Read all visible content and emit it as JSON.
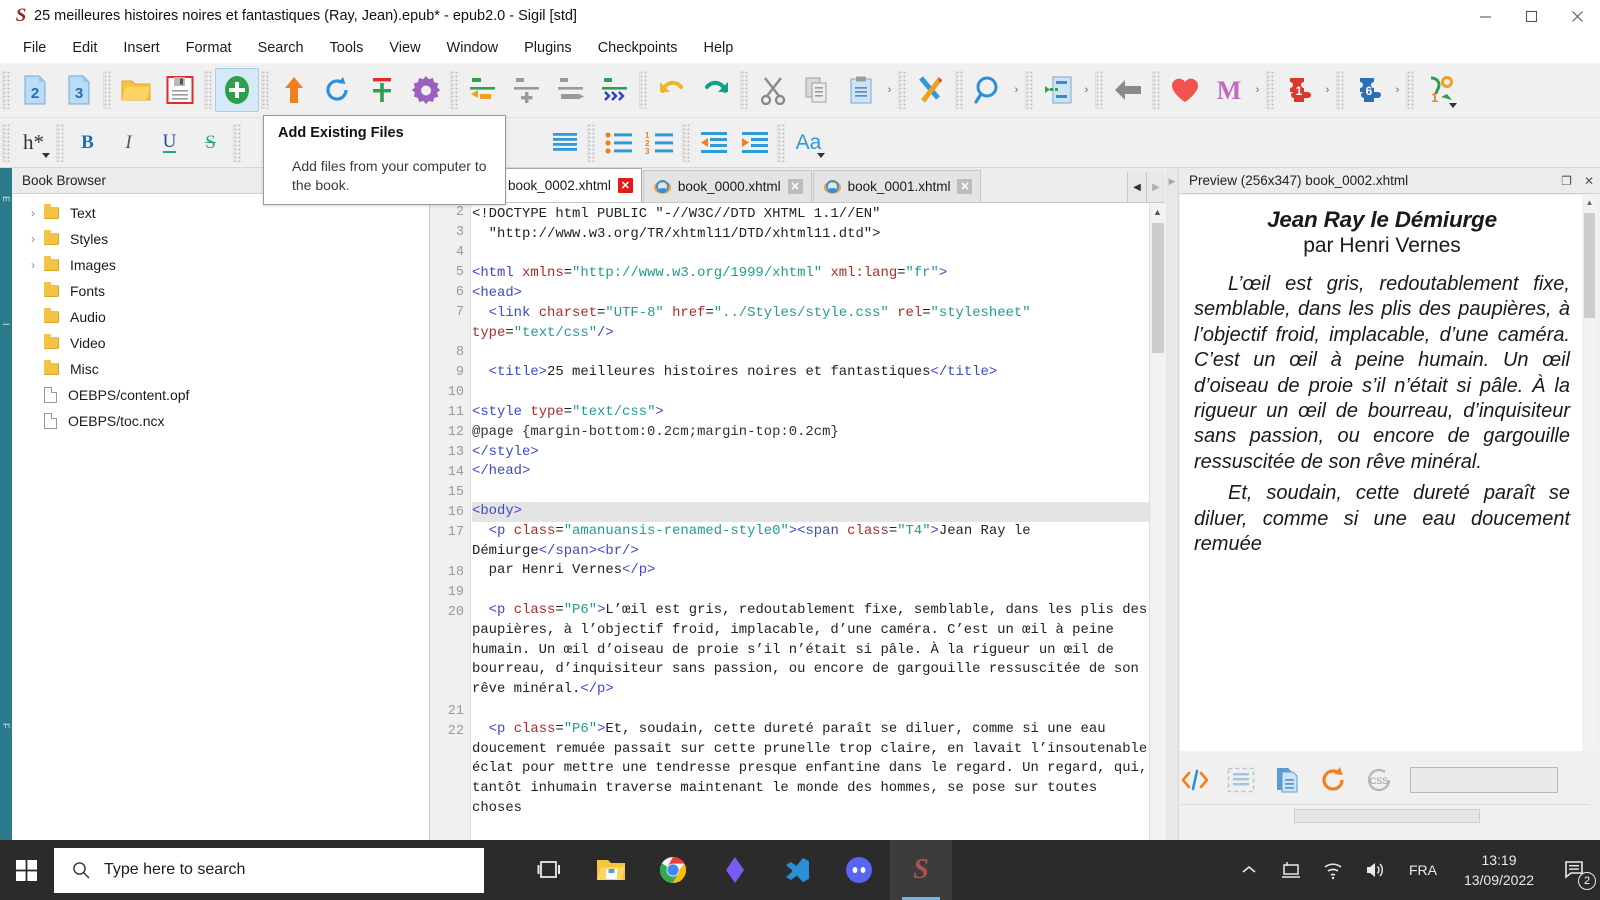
{
  "window": {
    "title": "25 meilleures histoires noires et fantastiques (Ray, Jean).epub* - epub2.0 - Sigil [std]",
    "app_glyph": "S",
    "minimize": "—",
    "maximize": "□",
    "close": "✕"
  },
  "menubar": {
    "items": [
      "File",
      "Edit",
      "Insert",
      "Format",
      "Search",
      "Tools",
      "View",
      "Window",
      "Plugins",
      "Checkpoints",
      "Help"
    ]
  },
  "toolbar_row1": {
    "groups": [
      {
        "buttons": [
          {
            "name": "epub2-icon",
            "label": "2"
          },
          {
            "name": "epub3-icon",
            "label": "3"
          }
        ]
      },
      {
        "buttons": [
          {
            "name": "open-folder-icon",
            "label": ""
          },
          {
            "name": "save-icon",
            "label": ""
          }
        ]
      },
      {
        "buttons": [
          {
            "name": "add-existing-files-icon",
            "label": "",
            "active": true
          }
        ]
      },
      {
        "buttons": [
          {
            "name": "upload-icon",
            "label": ""
          },
          {
            "name": "reload-icon",
            "label": ""
          },
          {
            "name": "add-blank-section-icon",
            "label": ""
          },
          {
            "name": "preferences-gear-icon",
            "label": ""
          }
        ]
      },
      {
        "buttons": [
          {
            "name": "split-at-cursor-icon",
            "label": ""
          },
          {
            "name": "insert-section-icon",
            "label": ""
          },
          {
            "name": "merge-icon",
            "label": ""
          },
          {
            "name": "split-at-markers-icon",
            "label": ""
          }
        ]
      },
      {
        "buttons": [
          {
            "name": "undo-icon",
            "label": ""
          },
          {
            "name": "redo-icon",
            "label": ""
          }
        ]
      },
      {
        "buttons": [
          {
            "name": "cut-icon",
            "label": ""
          },
          {
            "name": "copy-icon",
            "label": ""
          },
          {
            "name": "paste-icon",
            "label": ""
          }
        ]
      },
      {
        "buttons": [
          {
            "name": "metadata-editor-icon",
            "label": ""
          }
        ]
      },
      {
        "buttons": [
          {
            "name": "find-replace-icon",
            "label": ""
          }
        ]
      },
      {
        "buttons": [
          {
            "name": "generate-toc-icon",
            "label": ""
          }
        ]
      },
      {
        "buttons": [
          {
            "name": "back-arrow-icon",
            "label": ""
          }
        ]
      },
      {
        "buttons": [
          {
            "name": "heart-plugin-icon",
            "label": ""
          },
          {
            "name": "m-plugin-icon",
            "label": ""
          }
        ]
      },
      {
        "buttons": [
          {
            "name": "plugin-1-icon",
            "label": "1"
          }
        ]
      },
      {
        "buttons": [
          {
            "name": "plugin-6-icon",
            "label": "6"
          }
        ]
      },
      {
        "buttons": [
          {
            "name": "plugin-tools-icon",
            "label": ""
          }
        ]
      }
    ]
  },
  "toolbar_row2": {
    "heading_label": "h*",
    "bold_label": "B",
    "italic_label": "I",
    "underline_label": "U",
    "strike_label": "S",
    "case_label": "Aa",
    "buttons": [
      {
        "name": "heading-dropdown"
      },
      {
        "name": "bold-button"
      },
      {
        "name": "italic-button"
      },
      {
        "name": "underline-button"
      },
      {
        "name": "strikethrough-button"
      },
      {
        "name": "align-justify-button"
      },
      {
        "name": "bullet-list-button"
      },
      {
        "name": "numbered-list-button"
      },
      {
        "name": "decrease-indent-button"
      },
      {
        "name": "increase-indent-button"
      },
      {
        "name": "change-case-button"
      }
    ]
  },
  "tooltip": {
    "title": "Add Existing Files",
    "body": "Add files from your computer to the book."
  },
  "book_browser": {
    "panel_title": "Book Browser",
    "items": [
      {
        "label": "Text",
        "type": "folder",
        "expandable": true,
        "twisty": "›"
      },
      {
        "label": "Styles",
        "type": "folder",
        "expandable": true,
        "twisty": "›"
      },
      {
        "label": "Images",
        "type": "folder",
        "expandable": true,
        "twisty": "›"
      },
      {
        "label": "Fonts",
        "type": "folder",
        "expandable": false,
        "twisty": ""
      },
      {
        "label": "Audio",
        "type": "folder",
        "expandable": false,
        "twisty": ""
      },
      {
        "label": "Video",
        "type": "folder",
        "expandable": false,
        "twisty": ""
      },
      {
        "label": "Misc",
        "type": "folder",
        "expandable": false,
        "twisty": ""
      },
      {
        "label": "OEBPS/content.opf",
        "type": "file",
        "expandable": false,
        "twisty": ""
      },
      {
        "label": "OEBPS/toc.ncx",
        "type": "file",
        "expandable": false,
        "twisty": ""
      }
    ]
  },
  "left_strip": {
    "labels": [
      "E",
      "I",
      "F"
    ]
  },
  "tabs": {
    "items": [
      {
        "label": "book_0002.xhtml",
        "active": true
      },
      {
        "label": "book_0000.xhtml",
        "active": false
      },
      {
        "label": "book_0001.xhtml",
        "active": false
      }
    ],
    "close_glyph": "✕",
    "nav_prev": "◀",
    "nav_next": "▶"
  },
  "editor": {
    "first_line_number": 2,
    "highlighted_line": 16,
    "line_numbers": [
      2,
      3,
      4,
      5,
      6,
      7,
      8,
      9,
      10,
      11,
      12,
      13,
      14,
      15,
      16,
      17,
      18,
      19,
      20,
      21,
      22
    ],
    "lines": [
      {
        "n": 2,
        "segments": [
          {
            "t": "plain",
            "s": "<!DOCTYPE html PUBLIC \"-//W3C//DTD XHTML 1.1//EN\""
          }
        ]
      },
      {
        "n": 3,
        "segments": [
          {
            "t": "plain",
            "s": "  \"http://www.w3.org/TR/xhtml11/DTD/xhtml11.dtd\">"
          }
        ]
      },
      {
        "n": 4,
        "segments": [
          {
            "t": "plain",
            "s": ""
          }
        ]
      },
      {
        "n": 5,
        "segments": [
          {
            "t": "tagc",
            "s": "<html "
          },
          {
            "t": "attrc",
            "s": "xmlns"
          },
          {
            "t": "plain",
            "s": "="
          },
          {
            "t": "valc",
            "s": "\"http://www.w3.org/1999/xhtml\""
          },
          {
            "t": "plain",
            "s": " "
          },
          {
            "t": "attrc",
            "s": "xml:lang"
          },
          {
            "t": "plain",
            "s": "="
          },
          {
            "t": "valc",
            "s": "\"fr\""
          },
          {
            "t": "tagc",
            "s": ">"
          }
        ]
      },
      {
        "n": 6,
        "segments": [
          {
            "t": "tagc",
            "s": "<head>"
          }
        ]
      },
      {
        "n": 7,
        "segments": [
          {
            "t": "plain",
            "s": "  "
          },
          {
            "t": "tagc",
            "s": "<link "
          },
          {
            "t": "attrc",
            "s": "charset"
          },
          {
            "t": "plain",
            "s": "="
          },
          {
            "t": "valc",
            "s": "\"UTF-8\""
          },
          {
            "t": "plain",
            "s": " "
          },
          {
            "t": "attrc",
            "s": "href"
          },
          {
            "t": "plain",
            "s": "="
          },
          {
            "t": "valc",
            "s": "\"../Styles/style.css\""
          },
          {
            "t": "plain",
            "s": " "
          },
          {
            "t": "attrc",
            "s": "rel"
          },
          {
            "t": "plain",
            "s": "="
          },
          {
            "t": "valc",
            "s": "\"stylesheet\""
          },
          {
            "t": "plain",
            "s": " "
          },
          {
            "t": "attrc",
            "s": "type"
          },
          {
            "t": "plain",
            "s": "="
          },
          {
            "t": "valc",
            "s": "\"text/css\""
          },
          {
            "t": "tagc",
            "s": "/>"
          }
        ]
      },
      {
        "n": 8,
        "segments": [
          {
            "t": "plain",
            "s": ""
          }
        ]
      },
      {
        "n": 9,
        "segments": [
          {
            "t": "plain",
            "s": "  "
          },
          {
            "t": "tagc",
            "s": "<title>"
          },
          {
            "t": "plain",
            "s": "25 meilleures histoires noires et fantastiques"
          },
          {
            "t": "tagc",
            "s": "</title>"
          }
        ]
      },
      {
        "n": 10,
        "segments": [
          {
            "t": "plain",
            "s": ""
          }
        ]
      },
      {
        "n": 11,
        "segments": [
          {
            "t": "tagc",
            "s": "<style "
          },
          {
            "t": "attrc",
            "s": "type"
          },
          {
            "t": "plain",
            "s": "="
          },
          {
            "t": "valc",
            "s": "\"text/css\""
          },
          {
            "t": "tagc",
            "s": ">"
          }
        ]
      },
      {
        "n": 12,
        "segments": [
          {
            "t": "csstxt",
            "s": "@page {margin-bottom:0.2cm;margin-top:0.2cm}"
          }
        ]
      },
      {
        "n": 13,
        "segments": [
          {
            "t": "tagc",
            "s": "</style>"
          }
        ]
      },
      {
        "n": 14,
        "segments": [
          {
            "t": "tagc",
            "s": "</head>"
          }
        ]
      },
      {
        "n": 15,
        "segments": [
          {
            "t": "plain",
            "s": ""
          }
        ]
      },
      {
        "n": 16,
        "segments": [
          {
            "t": "tagc",
            "s": "<body>"
          }
        ],
        "highlight": true
      },
      {
        "n": 17,
        "segments": [
          {
            "t": "plain",
            "s": "  "
          },
          {
            "t": "tagc",
            "s": "<p "
          },
          {
            "t": "attrc",
            "s": "class"
          },
          {
            "t": "plain",
            "s": "="
          },
          {
            "t": "valc",
            "s": "\"amanuansis-renamed-style0\""
          },
          {
            "t": "tagc",
            "s": "><span "
          },
          {
            "t": "attrc",
            "s": "class"
          },
          {
            "t": "plain",
            "s": "="
          },
          {
            "t": "valc",
            "s": "\"T4\""
          },
          {
            "t": "tagc",
            "s": ">"
          },
          {
            "t": "plain",
            "s": "Jean Ray le Démiurge"
          },
          {
            "t": "tagc",
            "s": "</span><br/>"
          }
        ]
      },
      {
        "n": 18,
        "segments": [
          {
            "t": "plain",
            "s": "  par Henri Vernes"
          },
          {
            "t": "tagc",
            "s": "</p>"
          }
        ]
      },
      {
        "n": 19,
        "segments": [
          {
            "t": "plain",
            "s": ""
          }
        ]
      },
      {
        "n": 20,
        "segments": [
          {
            "t": "plain",
            "s": "  "
          },
          {
            "t": "tagc",
            "s": "<p "
          },
          {
            "t": "attrc",
            "s": "class"
          },
          {
            "t": "plain",
            "s": "="
          },
          {
            "t": "valc",
            "s": "\"P6\""
          },
          {
            "t": "tagc",
            "s": ">"
          },
          {
            "t": "plain",
            "s": "L’œil est gris, redoutablement fixe, semblable, dans les plis des paupières, à l’objectif froid, implacable, d’une caméra. C’est un œil à peine humain. Un œil d’oiseau de proie s’il n’était si pâle. À la rigueur un œil de bourreau, d’inquisiteur sans passion, ou encore de gargouille ressuscitée de son rêve minéral."
          },
          {
            "t": "tagc",
            "s": "</p>"
          }
        ]
      },
      {
        "n": 21,
        "segments": [
          {
            "t": "plain",
            "s": ""
          }
        ]
      },
      {
        "n": 22,
        "segments": [
          {
            "t": "plain",
            "s": "  "
          },
          {
            "t": "tagc",
            "s": "<p "
          },
          {
            "t": "attrc",
            "s": "class"
          },
          {
            "t": "plain",
            "s": "="
          },
          {
            "t": "valc",
            "s": "\"P6\""
          },
          {
            "t": "tagc",
            "s": ">"
          },
          {
            "t": "plain",
            "s": "Et, soudain, cette dureté paraît se diluer, comme si une eau doucement remuée passait sur cette prunelle trop claire, en lavait l’insoutenable éclat pour mettre une tendresse presque enfantine dans le regard. Un regard, qui, tantôt inhumain traverse maintenant le monde des hommes, se pose sur toutes choses"
          }
        ]
      }
    ]
  },
  "preview": {
    "title": "Preview (256x347) book_0002.xhtml",
    "float_glyph": "❐",
    "close_glyph": "✕",
    "heading": "Jean Ray le Démiurge",
    "subheading": "par Henri Vernes",
    "paragraphs": [
      "L’œil est gris, redoutablement fixe, semblable, dans les plis des paupières, à l’objectif froid, implacable, d’une caméra. C’est un œil à peine humain. Un œil d’oiseau de proie s’il n’était si pâle. À la rigueur un œil de bourreau, d’inquisiteur sans passion, ou encore de gargouille ressuscitée de son rêve minéral.",
      "Et, soudain, cette dureté paraît se diluer, comme si une eau doucement remuée"
    ],
    "toolbar_buttons": [
      {
        "name": "code-view-icon",
        "label": "</>"
      },
      {
        "name": "split-view-icon",
        "label": ""
      },
      {
        "name": "book-view-icon",
        "label": ""
      },
      {
        "name": "reload-preview-icon",
        "label": ""
      },
      {
        "name": "css-inspect-icon",
        "label": "CSS"
      }
    ],
    "input_value": ""
  },
  "taskbar": {
    "start_name": "start-button",
    "search_placeholder": "Type here to search",
    "apps": [
      {
        "name": "task-view-icon",
        "running": false
      },
      {
        "name": "file-explorer-icon",
        "running": false
      },
      {
        "name": "chrome-icon",
        "running": false
      },
      {
        "name": "unity-hub-icon",
        "running": false
      },
      {
        "name": "vscode-icon",
        "running": false
      },
      {
        "name": "discord-icon",
        "running": false
      },
      {
        "name": "sigil-icon",
        "running": true,
        "selected": true
      }
    ],
    "tray": {
      "show_hidden": "ⱏ",
      "language": "FRA",
      "time": "13:19",
      "date": "13/09/2022",
      "notification_count": "2"
    }
  }
}
